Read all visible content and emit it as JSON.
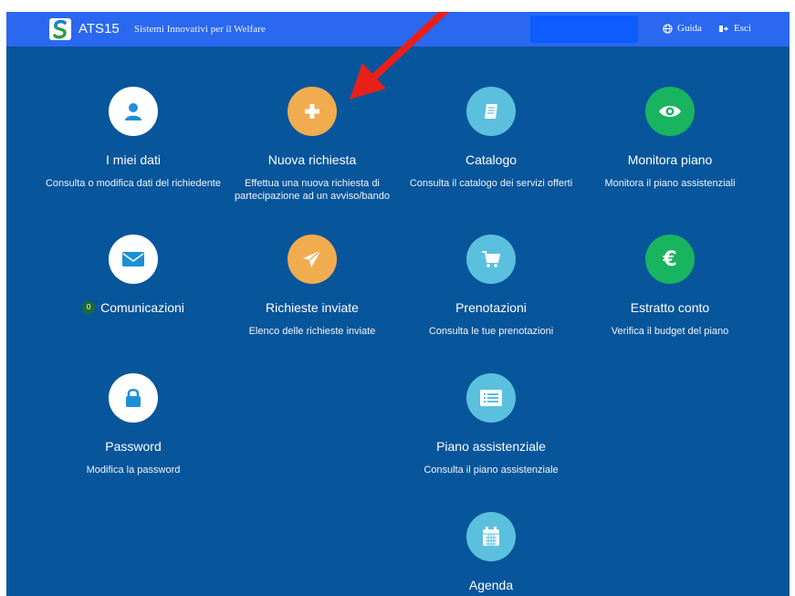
{
  "header": {
    "app_name": "ATS15",
    "tagline": "Sistemi Innovativi per il Welfare",
    "guide_label": "Guida",
    "exit_label": "Esci"
  },
  "tiles": [
    {
      "title": "I miei dati",
      "desc": "Consulta o modifica dati del richiedente",
      "icon": "user-icon"
    },
    {
      "title": "Nuova richiesta",
      "desc": "Effettua una nuova richiesta di partecipazione ad un avviso/bando",
      "icon": "plus-icon"
    },
    {
      "title": "Catalogo",
      "desc": "Consulta il catalogo dei servizi offerti",
      "icon": "book-icon"
    },
    {
      "title": "Monitora piano",
      "desc": "Monitora il piano assistenziali",
      "icon": "eye-icon"
    },
    {
      "title": "Comunicazioni",
      "desc": "",
      "icon": "envelope-icon",
      "badge": "0"
    },
    {
      "title": "Richieste inviate",
      "desc": "Elenco delle richieste inviate",
      "icon": "paper-plane-icon"
    },
    {
      "title": "Prenotazioni",
      "desc": "Consulta le tue prenotazioni",
      "icon": "cart-icon"
    },
    {
      "title": "Estratto conto",
      "desc": "Verifica il budget del piano",
      "icon": "euro-icon"
    },
    {
      "title": "Password",
      "desc": "Modifica la password",
      "icon": "lock-icon"
    },
    {
      "title": "Piano assistenziale",
      "desc": "Consulta il piano assistenziale",
      "icon": "list-icon"
    },
    {
      "title": "Agenda",
      "desc": "",
      "icon": "calendar-icon"
    }
  ],
  "colors": {
    "background": "#07559b",
    "header": "#2a68f0",
    "orange": "#f0ac4f",
    "cyan": "#5bc0de",
    "green": "#18b45f",
    "annotation_arrow": "#e8201a"
  }
}
